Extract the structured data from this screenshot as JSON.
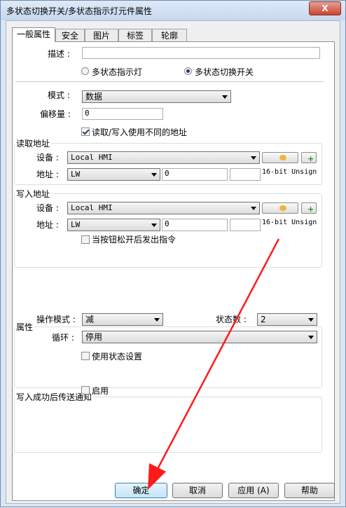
{
  "window": {
    "title": "多状态切换开关/多状态指示灯元件属性",
    "close_label": "X"
  },
  "tabs": [
    "一般属性",
    "安全",
    "图片",
    "标签",
    "轮廓"
  ],
  "general": {
    "description_label": "描述 :",
    "description_value": "",
    "radio_indicator": "多状态指示灯",
    "radio_switch": "多状态切换开关",
    "selected_radio": "多状态切换开关",
    "mode_label": "模式 :",
    "mode_value": "数据",
    "offset_label": "偏移量 :",
    "offset_value": "0",
    "diff_addr_label": "读取/写入使用不同的地址",
    "diff_addr_checked": true
  },
  "read_address": {
    "title": "读取地址",
    "device_label": "设备 :",
    "device_value": "Local HMI",
    "address_label": "地址 :",
    "address_type": "LW",
    "address_value": "0",
    "address_extra": "",
    "data_format": "16-bit Unsign"
  },
  "write_address": {
    "title": "写入地址",
    "device_label": "设备 :",
    "device_value": "Local HMI",
    "address_label": "地址 :",
    "address_type": "LW",
    "address_value": "0",
    "address_extra": "",
    "data_format": "16-bit Unsign",
    "release_label": "当按钮松开后发出指令",
    "release_checked": false
  },
  "properties": {
    "title": "属性",
    "op_mode_label": "操作模式 :",
    "op_mode_value": "减",
    "states_label": "状态数 :",
    "states_value": "2",
    "cycle_label": "循环 :",
    "cycle_value": "停用",
    "use_state_label": "使用状态设置",
    "use_state_checked": false
  },
  "notify": {
    "title": "写入成功后传送通知",
    "enable_label": "启用",
    "enable_checked": false
  },
  "buttons": {
    "ok": "确定",
    "cancel": "取消",
    "apply": "应用 (A)",
    "help": "帮助"
  },
  "colors": {
    "arrow": "#ff1a1a",
    "title_bar": "#c6d7ee",
    "default_button": "#c4e5f6"
  }
}
